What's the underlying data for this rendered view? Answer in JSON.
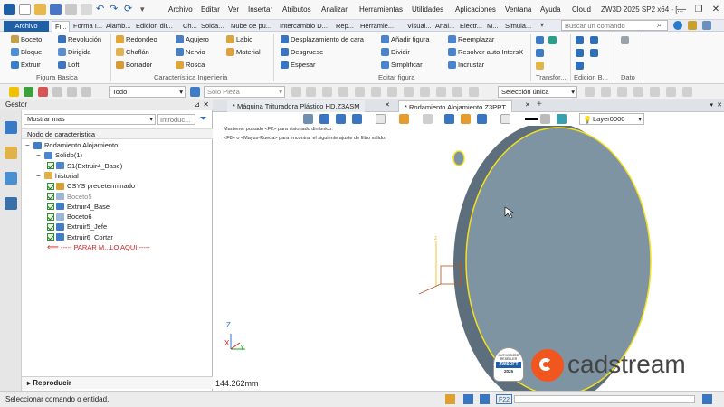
{
  "app": {
    "title": "ZW3D 2025 SP2 x64 - [..."
  },
  "menu": [
    "Archivo",
    "Editar",
    "Ver",
    "Insertar",
    "Atributos",
    "Analizar",
    "Herramientas",
    "Utilidades",
    "Aplicaciones",
    "Ventana",
    "Ayuda",
    "Cloud"
  ],
  "ribbon_tabs": [
    "Archivo",
    "Fi...",
    "Forma I...",
    "Alamb...",
    "Edicion dir...",
    "Ch...",
    "Solda...",
    "Nube de pu...",
    "Intercambio D...",
    "Rep...",
    "Herramie...",
    "Visual...",
    "Anal...",
    "Electr...",
    "M...",
    "Simula..."
  ],
  "search": {
    "placeholder": "Buscar un comando"
  },
  "ribbon": {
    "col1": [
      "Boceto",
      "Bloque",
      "Extruir"
    ],
    "col2": [
      "Revolución",
      "Dirigida",
      "Loft"
    ],
    "col3": [
      "Redondeo",
      "Chaflán",
      "Borrador"
    ],
    "col4": [
      "Agujero",
      "Nervio",
      "Rosca"
    ],
    "col5": [
      "Labio",
      "Material"
    ],
    "col6": [
      "Desplazamiento de cara",
      "Desgruese",
      "Espesar"
    ],
    "col7": [
      "Añadir figura",
      "Dividir",
      "Simplificar"
    ],
    "col8": [
      "Reemplazar",
      "Resolver auto IntersX",
      "Incrustar"
    ],
    "groups": [
      "Figura Basica",
      "Característica Ingenieria",
      "Editar figura",
      "Transfor...",
      "Edicion B...",
      "Dato"
    ]
  },
  "toolbar2": {
    "filter": "Todo",
    "part": "Solo Pieza",
    "selection": "Selección única"
  },
  "gestor": {
    "title": "Gestor",
    "mostrar": "Mostrar mas",
    "introduce_placeholder": "Introduc...",
    "column_header": "Nodo de característica",
    "tree": [
      {
        "label": "Rodamiento Alojamiento",
        "level": 0,
        "icon": "part-icon",
        "check": false,
        "expand": "−"
      },
      {
        "label": "Sólido(1)",
        "level": 1,
        "icon": "solid-icon",
        "check": false,
        "expand": "−"
      },
      {
        "label": "S1(Extruir4_Base)",
        "level": 2,
        "icon": "solid-icon",
        "check": true,
        "expand": ""
      },
      {
        "label": "historial",
        "level": 1,
        "icon": "folder-icon",
        "check": false,
        "expand": "−"
      },
      {
        "label": "CSYS predeterminado",
        "level": 2,
        "icon": "csys-icon",
        "check": true,
        "expand": ""
      },
      {
        "label": "Boceto5",
        "level": 2,
        "icon": "sketch-icon",
        "check": true,
        "expand": "",
        "muted": true
      },
      {
        "label": "Extruir4_Base",
        "level": 2,
        "icon": "extrude-icon",
        "check": true,
        "expand": ""
      },
      {
        "label": "Boceto6",
        "level": 2,
        "icon": "sketch-icon",
        "check": true,
        "expand": ""
      },
      {
        "label": "Extruir5_Jefe",
        "level": 2,
        "icon": "extrude-icon",
        "check": true,
        "expand": ""
      },
      {
        "label": "Extruir6_Cortar",
        "level": 2,
        "icon": "extrude-icon",
        "check": true,
        "expand": ""
      },
      {
        "label": "----- PARAR M...LO AQUI -----",
        "level": 2,
        "icon": "stop-arrow-icon",
        "check": false,
        "expand": "",
        "stop": true
      }
    ],
    "reproducir": "Reproducir"
  },
  "doc_tabs": [
    "* Máquina Trituradora Plástico HD.Z3ASM",
    "* Rodamiento Alojamiento.Z3PRT"
  ],
  "layer": "Layer0000",
  "viewport": {
    "hint1": "Mantener pulsado <F2> para visionado dinámico.",
    "hint2": "<F8> o <Mayus-Rueda> para encontrar el siguiente ajuste de filtro valido.",
    "measure": "144.262mm",
    "axes": {
      "x": "X",
      "y": "Y",
      "z": "Z"
    },
    "badge": [
      "AUTHORIZED",
      "RESELLER",
      "ZWSOFT",
      "2025"
    ],
    "brand": "cadstream"
  },
  "status": {
    "text": "Seleccionar comando o entidad.",
    "key": "F22"
  },
  "colors": {
    "accent": "#1f5fa8",
    "part_face": "#7f94a3",
    "highlight": "#f4e020",
    "brand_orange": "#f0561e",
    "stop_red": "#d42020"
  }
}
